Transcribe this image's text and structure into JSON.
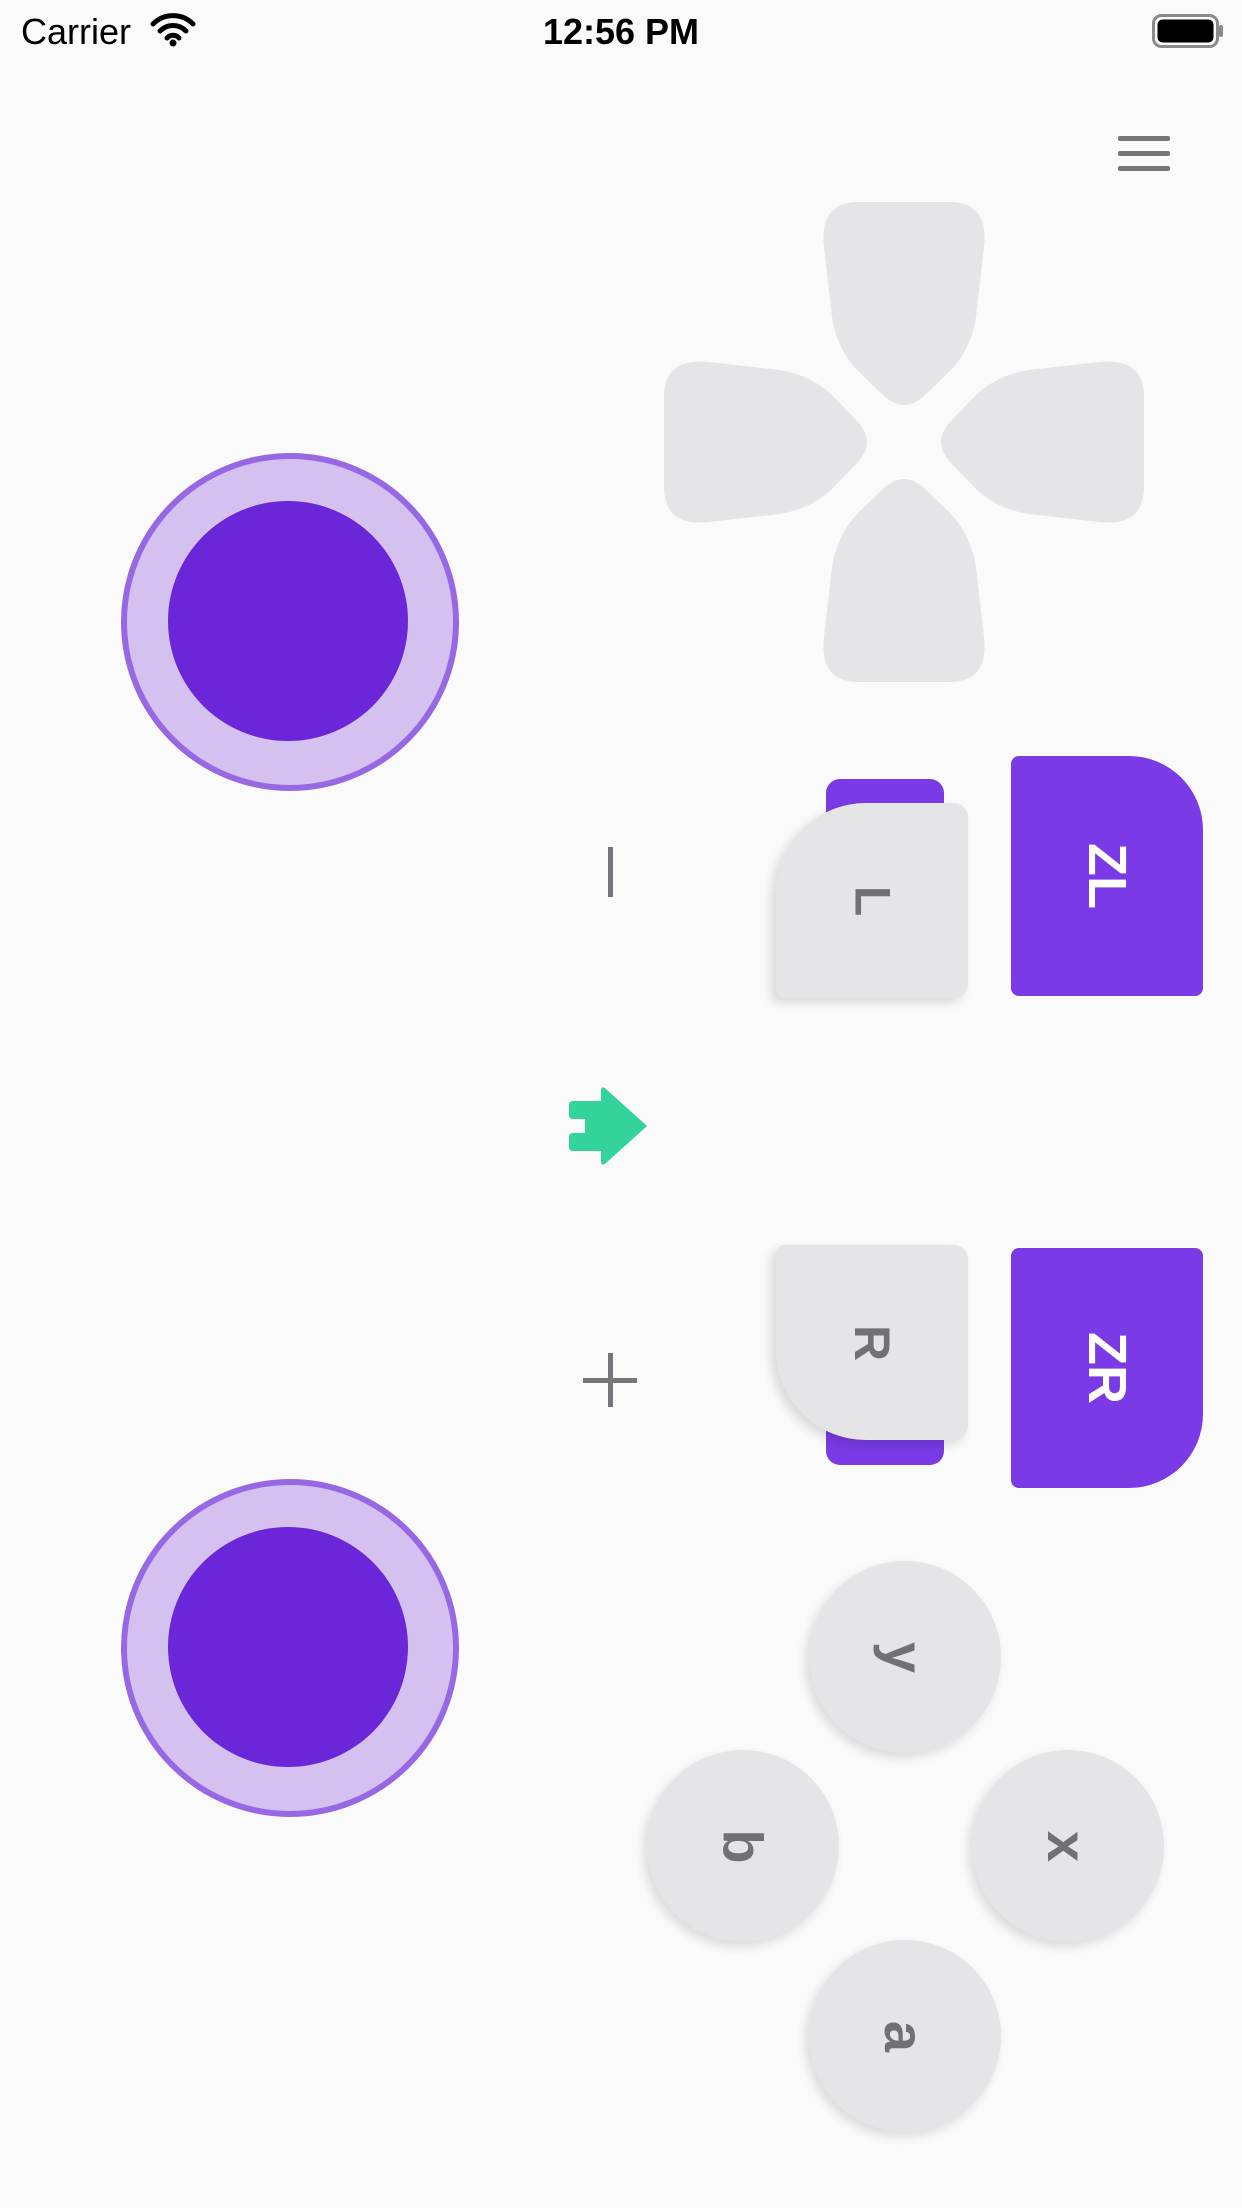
{
  "status_bar": {
    "carrier": "Carrier",
    "time": "12:56 PM"
  },
  "icons": {
    "menu": "hamburger-menu-icon",
    "wifi": "wifi-icon",
    "battery": "battery-icon",
    "home": "home-arrow-icon"
  },
  "colors": {
    "background": "#fafafa",
    "purple_accent": "#7a3be6",
    "stick_knob": "#6b26d9",
    "stick_ring": "#d4c1f0",
    "stick_border": "#9768e3",
    "button_gray": "#e5e5e7",
    "label_gray": "#717074",
    "home_green": "#34d399"
  },
  "controls": {
    "shoulder": {
      "l": "L",
      "r": "R",
      "zl": "ZL",
      "zr": "ZR"
    },
    "face": {
      "y": "y",
      "b": "b",
      "x": "x",
      "a": "a"
    }
  }
}
